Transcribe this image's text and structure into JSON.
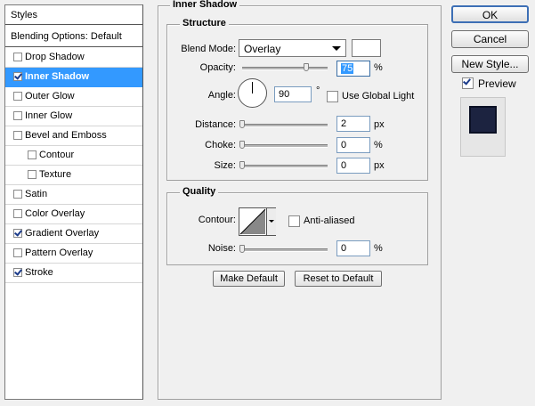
{
  "styles_panel": {
    "header": "Styles",
    "blending_options": "Blending Options: Default",
    "items": [
      {
        "label": "Drop Shadow",
        "checked": false
      },
      {
        "label": "Inner Shadow",
        "checked": true,
        "selected": true
      },
      {
        "label": "Outer Glow",
        "checked": false
      },
      {
        "label": "Inner Glow",
        "checked": false
      },
      {
        "label": "Bevel and Emboss",
        "checked": false
      },
      {
        "label": "Contour",
        "checked": false
      },
      {
        "label": "Texture",
        "checked": false
      },
      {
        "label": "Satin",
        "checked": false
      },
      {
        "label": "Color Overlay",
        "checked": false
      },
      {
        "label": "Gradient Overlay",
        "checked": true
      },
      {
        "label": "Pattern Overlay",
        "checked": false
      },
      {
        "label": "Stroke",
        "checked": true
      }
    ]
  },
  "main": {
    "title": "Inner Shadow",
    "structure": {
      "title": "Structure",
      "blend_mode_label": "Blend Mode:",
      "blend_mode_value": "Overlay",
      "swatch_color": "#ffffff",
      "opacity_label": "Opacity:",
      "opacity_value": "75",
      "opacity_unit": "%",
      "opacity_level": 0.75,
      "angle_label": "Angle:",
      "angle_value": "90",
      "angle_unit": "°",
      "global_light_label": "Use Global Light",
      "global_light_checked": false,
      "distance_label": "Distance:",
      "distance_value": "2",
      "distance_unit": "px",
      "choke_label": "Choke:",
      "choke_value": "0",
      "choke_unit": "%",
      "size_label": "Size:",
      "size_value": "0",
      "size_unit": "px"
    },
    "quality": {
      "title": "Quality",
      "contour_label": "Contour:",
      "anti_aliased_label": "Anti-aliased",
      "anti_aliased_checked": false,
      "noise_label": "Noise:",
      "noise_value": "0",
      "noise_unit": "%"
    },
    "make_default": "Make Default",
    "reset_default": "Reset to Default"
  },
  "right": {
    "ok": "OK",
    "cancel": "Cancel",
    "new_style": "New Style...",
    "preview_label": "Preview",
    "preview_checked": true,
    "preview_color": "#1c2340"
  },
  "colors": {
    "selection": "#3399ff",
    "background": "#f0f0f0"
  }
}
